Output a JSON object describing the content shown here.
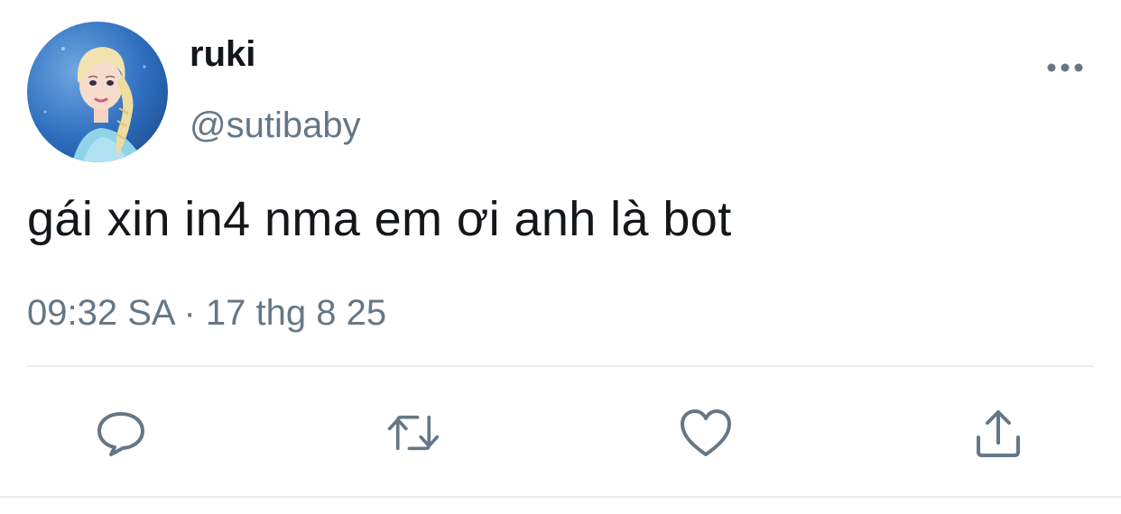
{
  "user": {
    "display_name": "ruki",
    "handle": "@sutibaby",
    "avatar_icon": "avatar-image"
  },
  "tweet": {
    "text": "gái xin in4 nma em ơi anh là bot",
    "timestamp": "09:32 SA · 17 thg 8 25"
  },
  "actions": [
    {
      "name": "reply",
      "icon": "speech-bubble-icon"
    },
    {
      "name": "retweet",
      "icon": "retweet-icon"
    },
    {
      "name": "like",
      "icon": "heart-icon"
    },
    {
      "name": "share",
      "icon": "share-icon"
    }
  ],
  "menu": {
    "icon": "more-dots-icon"
  },
  "colors": {
    "text_primary": "#14171a",
    "text_secondary": "#657786",
    "icon": "#657786",
    "divider": "#e6ecf0"
  }
}
